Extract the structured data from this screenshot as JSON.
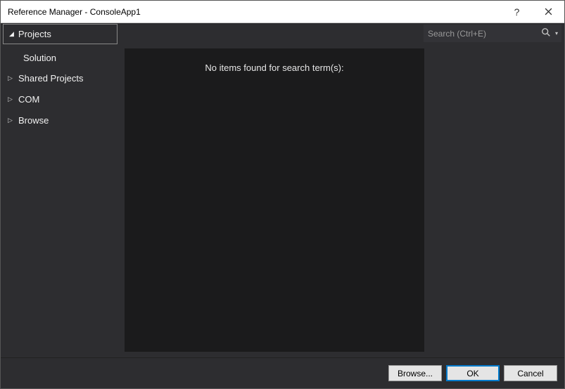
{
  "titlebar": {
    "title": "Reference Manager - ConsoleApp1"
  },
  "toprow": {
    "selected_tab": "Projects",
    "search_placeholder": "Search (Ctrl+E)"
  },
  "sidebar": {
    "items": [
      {
        "label": "Solution",
        "sub": true
      },
      {
        "label": "Shared Projects"
      },
      {
        "label": "COM"
      },
      {
        "label": "Browse"
      }
    ]
  },
  "main": {
    "empty_message": "No items found for search term(s):"
  },
  "footer": {
    "browse_label": "Browse...",
    "ok_label": "OK",
    "cancel_label": "Cancel"
  }
}
